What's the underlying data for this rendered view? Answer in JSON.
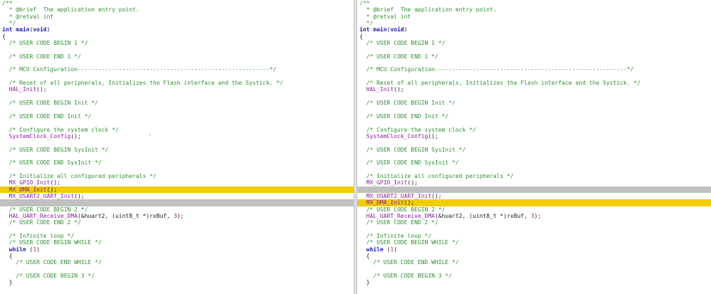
{
  "left": [
    {
      "state": "normal",
      "tokens": [
        [
          "comment",
          "/**"
        ]
      ]
    },
    {
      "state": "normal",
      "tokens": [
        [
          "comment",
          "  * @brief  The application entry point."
        ]
      ]
    },
    {
      "state": "normal",
      "tokens": [
        [
          "comment",
          "  * @retval int"
        ]
      ]
    },
    {
      "state": "normal",
      "tokens": [
        [
          "comment",
          "  */"
        ]
      ]
    },
    {
      "state": "normal",
      "tokens": [
        [
          "keyword",
          "int main"
        ],
        [
          "punct",
          "("
        ],
        [
          "keyword",
          "void"
        ],
        [
          "punct",
          ")"
        ]
      ]
    },
    {
      "state": "normal",
      "tokens": [
        [
          "punct",
          "{"
        ]
      ]
    },
    {
      "state": "normal",
      "tokens": [
        [
          "comment",
          "  /* USER CODE BEGIN 1 */"
        ]
      ]
    },
    {
      "state": "normal",
      "tokens": []
    },
    {
      "state": "normal",
      "tokens": [
        [
          "comment",
          "  /* USER CODE END 1 */"
        ]
      ]
    },
    {
      "state": "normal",
      "tokens": []
    },
    {
      "state": "normal",
      "tokens": [
        [
          "comment",
          "  /* MCU Configuration--------------------------------------------------------*/"
        ]
      ]
    },
    {
      "state": "normal",
      "tokens": []
    },
    {
      "state": "normal",
      "tokens": [
        [
          "comment",
          "  /* Reset of all peripherals, Initializes the Flash interface and the Systick. */"
        ]
      ]
    },
    {
      "state": "normal",
      "tokens": [
        [
          "plain",
          "  "
        ],
        [
          "func",
          "HAL_Init"
        ],
        [
          "punct",
          "();"
        ]
      ]
    },
    {
      "state": "normal",
      "tokens": []
    },
    {
      "state": "normal",
      "tokens": [
        [
          "comment",
          "  /* USER CODE BEGIN Init */"
        ]
      ]
    },
    {
      "state": "normal",
      "tokens": []
    },
    {
      "state": "normal",
      "tokens": [
        [
          "comment",
          "  /* USER CODE END Init */"
        ]
      ]
    },
    {
      "state": "normal",
      "tokens": []
    },
    {
      "state": "normal",
      "tokens": [
        [
          "comment",
          "  /* Configure the system clock */"
        ]
      ]
    },
    {
      "state": "normal",
      "tokens": [
        [
          "plain",
          "  "
        ],
        [
          "func",
          "SystemClock_Config"
        ],
        [
          "punct",
          "();"
        ]
      ]
    },
    {
      "state": "normal",
      "tokens": []
    },
    {
      "state": "normal",
      "tokens": [
        [
          "comment",
          "  /* USER CODE BEGIN SysInit */"
        ]
      ]
    },
    {
      "state": "normal",
      "tokens": []
    },
    {
      "state": "normal",
      "tokens": [
        [
          "comment",
          "  /* USER CODE END SysInit */"
        ]
      ]
    },
    {
      "state": "normal",
      "tokens": []
    },
    {
      "state": "normal",
      "tokens": [
        [
          "comment",
          "  /* Initialize all configured peripherals */"
        ]
      ]
    },
    {
      "state": "normal",
      "tokens": [
        [
          "plain",
          "  "
        ],
        [
          "func",
          "MX_GPIO_Init"
        ],
        [
          "punct",
          "();"
        ]
      ]
    },
    {
      "state": "changed",
      "tokens": [
        [
          "plain",
          "  "
        ],
        [
          "func",
          "MX_DMA_Init"
        ],
        [
          "punct",
          "();"
        ]
      ]
    },
    {
      "state": "normal",
      "tokens": [
        [
          "plain",
          "  "
        ],
        [
          "func",
          "MX_USART2_UART_Init"
        ],
        [
          "punct",
          "();"
        ]
      ]
    },
    {
      "state": "placeholder",
      "tokens": []
    },
    {
      "state": "normal",
      "tokens": [
        [
          "comment",
          "  /* USER CODE BEGIN 2 */"
        ]
      ]
    },
    {
      "state": "normal",
      "tokens": [
        [
          "plain",
          "  "
        ],
        [
          "func",
          "HAL_UART_Receive_DMA"
        ],
        [
          "punct",
          "(&huart2, (uint8_t *)rxBuf, "
        ],
        [
          "num",
          "3"
        ],
        [
          "punct",
          ");"
        ]
      ]
    },
    {
      "state": "normal",
      "tokens": [
        [
          "comment",
          "  /* USER CODE END 2 */"
        ]
      ]
    },
    {
      "state": "normal",
      "tokens": []
    },
    {
      "state": "normal",
      "tokens": [
        [
          "comment",
          "  /* Infinite loop */"
        ]
      ]
    },
    {
      "state": "normal",
      "tokens": [
        [
          "comment",
          "  /* USER CODE BEGIN WHILE */"
        ]
      ]
    },
    {
      "state": "normal",
      "tokens": [
        [
          "plain",
          "  "
        ],
        [
          "keyword",
          "while"
        ],
        [
          "punct",
          " ("
        ],
        [
          "num",
          "1"
        ],
        [
          "punct",
          ")"
        ]
      ]
    },
    {
      "state": "normal",
      "tokens": [
        [
          "punct",
          "  {"
        ]
      ]
    },
    {
      "state": "normal",
      "tokens": [
        [
          "comment",
          "    /* USER CODE END WHILE */"
        ]
      ]
    },
    {
      "state": "normal",
      "tokens": []
    },
    {
      "state": "normal",
      "tokens": [
        [
          "comment",
          "    /* USER CODE BEGIN 3 */"
        ]
      ]
    },
    {
      "state": "normal",
      "tokens": [
        [
          "punct",
          "  }"
        ]
      ]
    }
  ],
  "right": [
    {
      "state": "normal",
      "tokens": [
        [
          "comment",
          "/**"
        ]
      ]
    },
    {
      "state": "normal",
      "tokens": [
        [
          "comment",
          "  * @brief  The application entry point."
        ]
      ]
    },
    {
      "state": "normal",
      "tokens": [
        [
          "comment",
          "  * @retval int"
        ]
      ]
    },
    {
      "state": "normal",
      "tokens": [
        [
          "comment",
          "  */"
        ]
      ]
    },
    {
      "state": "normal",
      "tokens": [
        [
          "keyword",
          "int main"
        ],
        [
          "punct",
          "("
        ],
        [
          "keyword",
          "void"
        ],
        [
          "punct",
          ")"
        ]
      ]
    },
    {
      "state": "normal",
      "tokens": [
        [
          "punct",
          "{"
        ]
      ]
    },
    {
      "state": "normal",
      "tokens": [
        [
          "comment",
          "  /* USER CODE BEGIN 1 */"
        ]
      ]
    },
    {
      "state": "normal",
      "tokens": []
    },
    {
      "state": "normal",
      "tokens": [
        [
          "comment",
          "  /* USER CODE END 1 */"
        ]
      ]
    },
    {
      "state": "normal",
      "tokens": []
    },
    {
      "state": "normal",
      "tokens": [
        [
          "comment",
          "  /* MCU Configuration--------------------------------------------------------*/"
        ]
      ]
    },
    {
      "state": "normal",
      "tokens": []
    },
    {
      "state": "normal",
      "tokens": [
        [
          "comment",
          "  /* Reset of all peripherals, Initializes the Flash interface and the Systick. */"
        ]
      ]
    },
    {
      "state": "normal",
      "tokens": [
        [
          "plain",
          "  "
        ],
        [
          "func",
          "HAL_Init"
        ],
        [
          "punct",
          "();"
        ]
      ]
    },
    {
      "state": "normal",
      "tokens": []
    },
    {
      "state": "normal",
      "tokens": [
        [
          "comment",
          "  /* USER CODE BEGIN Init */"
        ]
      ]
    },
    {
      "state": "normal",
      "tokens": []
    },
    {
      "state": "normal",
      "tokens": [
        [
          "comment",
          "  /* USER CODE END Init */"
        ]
      ]
    },
    {
      "state": "normal",
      "tokens": []
    },
    {
      "state": "normal",
      "tokens": [
        [
          "comment",
          "  /* Configure the system clock */"
        ]
      ]
    },
    {
      "state": "normal",
      "tokens": [
        [
          "plain",
          "  "
        ],
        [
          "func",
          "SystemClock_Config"
        ],
        [
          "punct",
          "();"
        ]
      ]
    },
    {
      "state": "normal",
      "tokens": []
    },
    {
      "state": "normal",
      "tokens": [
        [
          "comment",
          "  /* USER CODE BEGIN SysInit */"
        ]
      ]
    },
    {
      "state": "normal",
      "tokens": []
    },
    {
      "state": "normal",
      "tokens": [
        [
          "comment",
          "  /* USER CODE END SysInit */"
        ]
      ]
    },
    {
      "state": "normal",
      "tokens": []
    },
    {
      "state": "normal",
      "tokens": [
        [
          "comment",
          "  /* Initialize all configured peripherals */"
        ]
      ]
    },
    {
      "state": "normal",
      "tokens": [
        [
          "plain",
          "  "
        ],
        [
          "func",
          "MX_GPIO_Init"
        ],
        [
          "punct",
          "();"
        ]
      ]
    },
    {
      "state": "placeholder",
      "tokens": []
    },
    {
      "state": "normal",
      "tokens": [
        [
          "plain",
          "  "
        ],
        [
          "func",
          "MX_USART2_UART_Init"
        ],
        [
          "punct",
          "();"
        ]
      ]
    },
    {
      "state": "changed",
      "tokens": [
        [
          "plain",
          "  "
        ],
        [
          "func",
          "MX_DMA_Init"
        ],
        [
          "punct",
          "();"
        ]
      ]
    },
    {
      "state": "normal",
      "tokens": [
        [
          "comment",
          "  /* USER CODE BEGIN 2 */"
        ]
      ]
    },
    {
      "state": "normal",
      "tokens": [
        [
          "plain",
          "  "
        ],
        [
          "func",
          "HAL_UART_Receive_DMA"
        ],
        [
          "punct",
          "(&huart2, (uint8_t *)rxBuf, "
        ],
        [
          "num",
          "3"
        ],
        [
          "punct",
          ");"
        ]
      ]
    },
    {
      "state": "normal",
      "tokens": [
        [
          "comment",
          "  /* USER CODE END 2 */"
        ]
      ]
    },
    {
      "state": "normal",
      "tokens": []
    },
    {
      "state": "normal",
      "tokens": [
        [
          "comment",
          "  /* Infinite loop */"
        ]
      ]
    },
    {
      "state": "normal",
      "tokens": [
        [
          "comment",
          "  /* USER CODE BEGIN WHILE */"
        ]
      ]
    },
    {
      "state": "normal",
      "tokens": [
        [
          "plain",
          "  "
        ],
        [
          "keyword",
          "while"
        ],
        [
          "punct",
          " ("
        ],
        [
          "num",
          "1"
        ],
        [
          "punct",
          ")"
        ]
      ]
    },
    {
      "state": "normal",
      "tokens": [
        [
          "punct",
          "  {"
        ]
      ]
    },
    {
      "state": "normal",
      "tokens": [
        [
          "comment",
          "    /* USER CODE END WHILE */"
        ]
      ]
    },
    {
      "state": "normal",
      "tokens": []
    },
    {
      "state": "normal",
      "tokens": [
        [
          "comment",
          "    /* USER CODE BEGIN 3 */"
        ]
      ]
    },
    {
      "state": "normal",
      "tokens": [
        [
          "punct",
          "  }"
        ]
      ]
    }
  ]
}
